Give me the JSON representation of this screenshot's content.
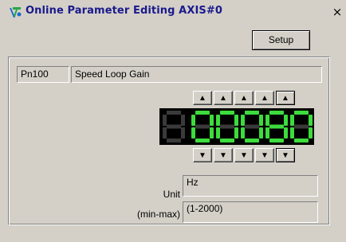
{
  "window": {
    "title": "Online Parameter Editing AXIS#0",
    "close_label": "×",
    "app_icon": "servo-app-icon"
  },
  "toolbar": {
    "setup_label": "Setup"
  },
  "parameter": {
    "code": "Pn100",
    "name": "Speed Loop Gain",
    "display_digits": "00080",
    "display_value": 80,
    "active_digit_index": 4
  },
  "arrows": {
    "up_icon": "up-arrow-icon",
    "down_icon": "down-arrow-icon",
    "up_glyph": "▲",
    "down_glyph": "▼"
  },
  "unit": {
    "label": "Unit",
    "value": "Hz"
  },
  "range": {
    "label": "(min-max)",
    "value": "(1-2000)"
  },
  "colors": {
    "background": "#d4d0c8",
    "display_background": "#000000",
    "segment_on": "#3ddc3d",
    "segment_off": "#3a3a3a",
    "title_text": "#1a1a8c"
  }
}
